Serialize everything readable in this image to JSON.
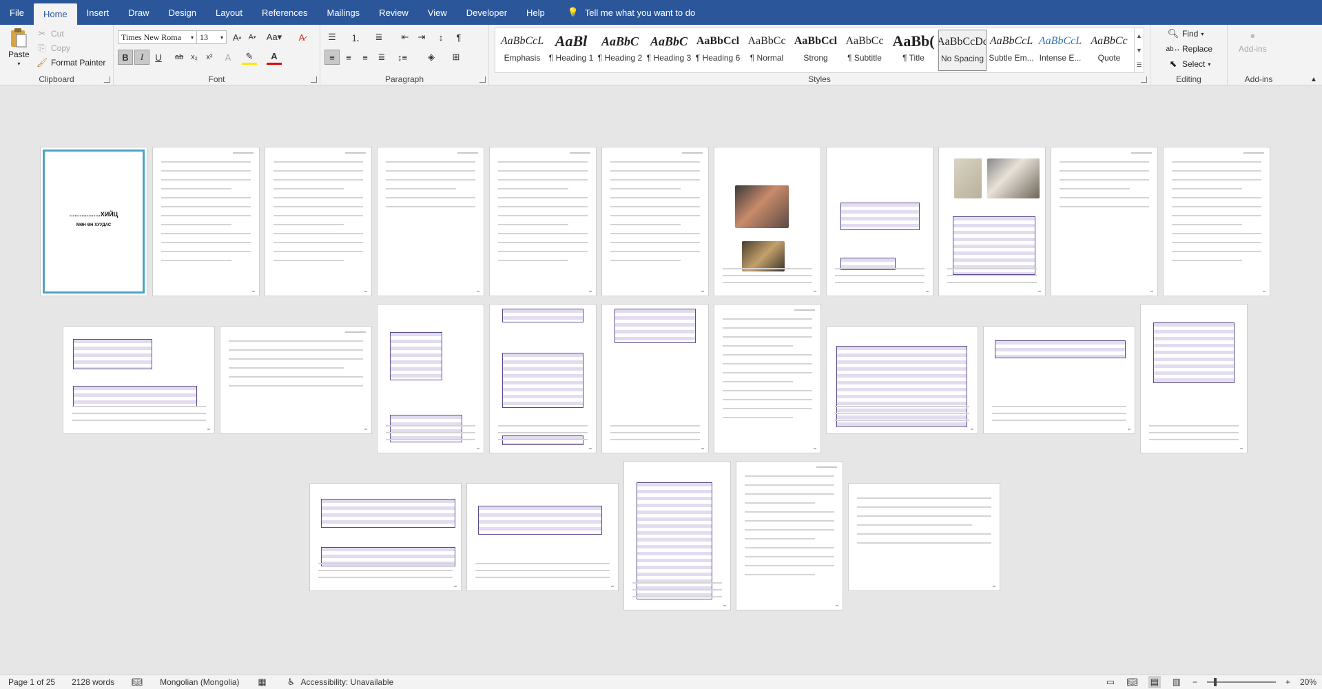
{
  "menu": {
    "tabs": [
      "File",
      "Home",
      "Insert",
      "Draw",
      "Design",
      "Layout",
      "References",
      "Mailings",
      "Review",
      "View",
      "Developer",
      "Help"
    ],
    "active_tab": "Home",
    "tell_me": "Tell me what you want to do"
  },
  "clipboard": {
    "paste": "Paste",
    "cut": "Cut",
    "copy": "Copy",
    "format_painter": "Format Painter",
    "label": "Clipboard"
  },
  "font": {
    "family": "Times New Roma",
    "size": "13",
    "label": "Font"
  },
  "paragraph": {
    "label": "Paragraph"
  },
  "styles": {
    "label": "Styles",
    "items": [
      {
        "sample": "AaBbCcL",
        "name": "Emphasis"
      },
      {
        "sample": "AaBl",
        "name": "¶ Heading 1"
      },
      {
        "sample": "AaBbC",
        "name": "¶ Heading 2"
      },
      {
        "sample": "AaBbC",
        "name": "¶ Heading 3"
      },
      {
        "sample": "AaBbCcl",
        "name": "¶ Heading 6"
      },
      {
        "sample": "AaBbCc",
        "name": "¶ Normal"
      },
      {
        "sample": "AaBbCcl",
        "name": "Strong"
      },
      {
        "sample": "AaBbCc",
        "name": "¶ Subtitle"
      },
      {
        "sample": "AaBb(",
        "name": "¶ Title"
      },
      {
        "sample": "AaBbCcDc",
        "name": "No Spacing"
      },
      {
        "sample": "AaBbCcL",
        "name": "Subtle Em..."
      },
      {
        "sample": "AaBbCcL",
        "name": "Intense E..."
      },
      {
        "sample": "AaBbCc",
        "name": "Quote"
      }
    ],
    "selected_index": 9
  },
  "editing": {
    "label": "Editing",
    "find": "Find",
    "replace": "Replace",
    "select": "Select"
  },
  "addins": {
    "label": "Add-ins",
    "button": "Add-ins"
  },
  "document": {
    "cover_title": "..................ХИЙЦ",
    "cover_subtitle": "МӨН ӨН ХУУДАС"
  },
  "status": {
    "page": "Page 1 of 25",
    "words": "2128 words",
    "language": "Mongolian (Mongolia)",
    "accessibility": "Accessibility: Unavailable",
    "zoom": "20%",
    "zoom_fraction": 0.2
  }
}
